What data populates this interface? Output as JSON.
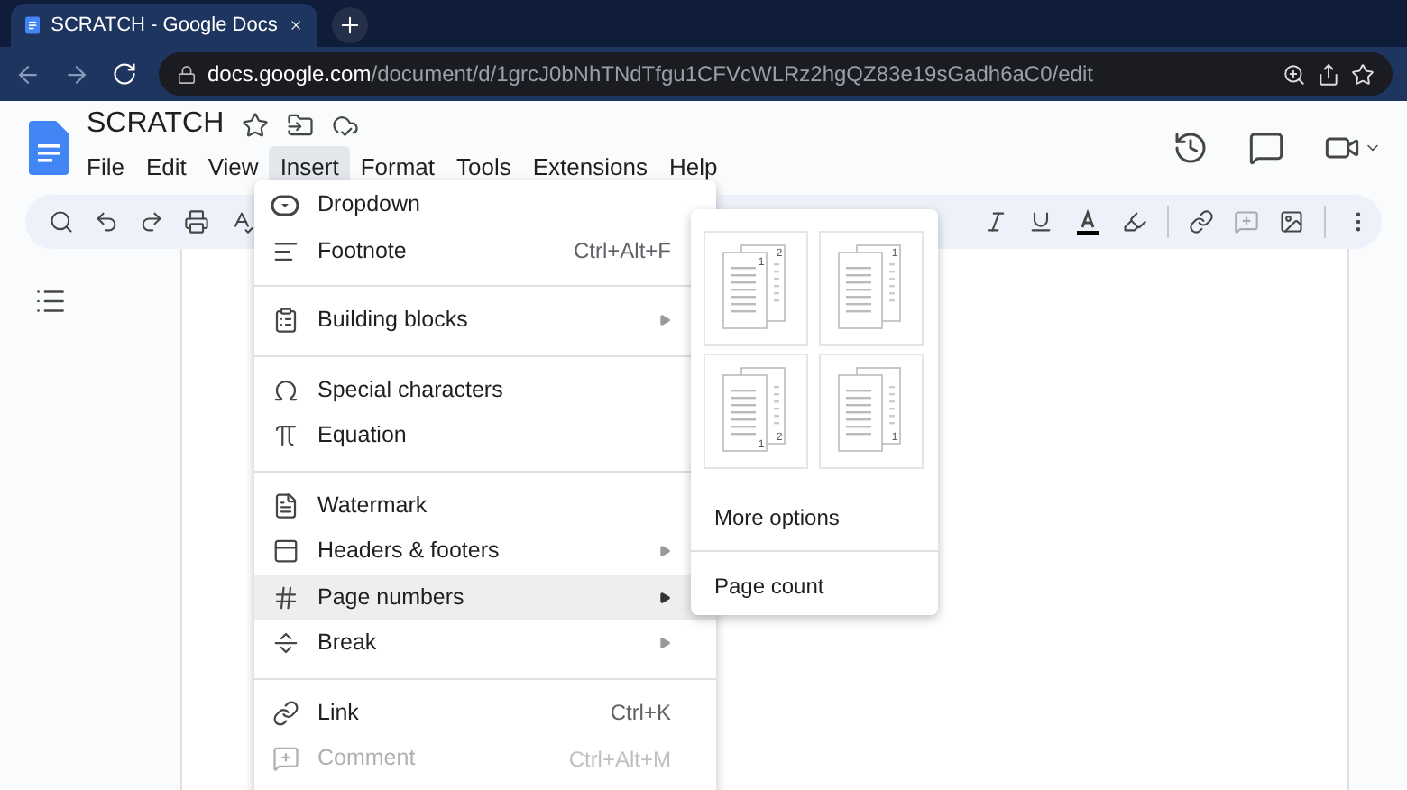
{
  "browser": {
    "tab": {
      "title": "SCRATCH - Google Docs",
      "selected": true
    },
    "url": {
      "host": "docs.google.com",
      "path": "/document/d/1grcJ0bNhTNdTfgu1CFVcWLRz2hgQZ83e19sGadh6aC0/edit"
    }
  },
  "doc": {
    "title": "SCRATCH"
  },
  "menubar": [
    {
      "label": "File",
      "selected": false
    },
    {
      "label": "Edit",
      "selected": false
    },
    {
      "label": "View",
      "selected": false
    },
    {
      "label": "Insert",
      "selected": true
    },
    {
      "label": "Format",
      "selected": false
    },
    {
      "label": "Tools",
      "selected": false
    },
    {
      "label": "Extensions",
      "selected": false
    },
    {
      "label": "Help",
      "selected": false
    }
  ],
  "insert_menu": {
    "groups": [
      [
        {
          "label": "Dropdown",
          "submenu": false,
          "selected": false,
          "disabled": false
        },
        {
          "label": "Footnote",
          "shortcut": "Ctrl+Alt+F",
          "submenu": false,
          "selected": false,
          "disabled": false
        }
      ],
      [
        {
          "label": "Building blocks",
          "submenu": true,
          "selected": false,
          "disabled": false
        }
      ],
      [
        {
          "label": "Special characters",
          "submenu": false,
          "selected": false,
          "disabled": false
        },
        {
          "label": "Equation",
          "submenu": false,
          "selected": false,
          "disabled": false
        }
      ],
      [
        {
          "label": "Watermark",
          "submenu": false,
          "selected": false,
          "disabled": false
        },
        {
          "label": "Headers & footers",
          "submenu": true,
          "selected": false,
          "disabled": false
        },
        {
          "label": "Page numbers",
          "submenu": true,
          "selected": true,
          "disabled": false
        },
        {
          "label": "Break",
          "submenu": true,
          "selected": false,
          "disabled": false
        }
      ],
      [
        {
          "label": "Link",
          "shortcut": "Ctrl+K",
          "submenu": false,
          "selected": false,
          "disabled": false
        },
        {
          "label": "Comment",
          "shortcut": "Ctrl+Alt+M",
          "submenu": false,
          "selected": false,
          "disabled": true
        }
      ]
    ]
  },
  "page_numbers_menu": {
    "thumbnails": [
      {
        "kind": "top",
        "front": "1",
        "back": "2"
      },
      {
        "kind": "top",
        "back": "1"
      },
      {
        "kind": "bottom",
        "front": "1",
        "back": "2"
      },
      {
        "kind": "bottom",
        "back": "1"
      }
    ],
    "options": [
      "More options",
      "Page count"
    ]
  }
}
